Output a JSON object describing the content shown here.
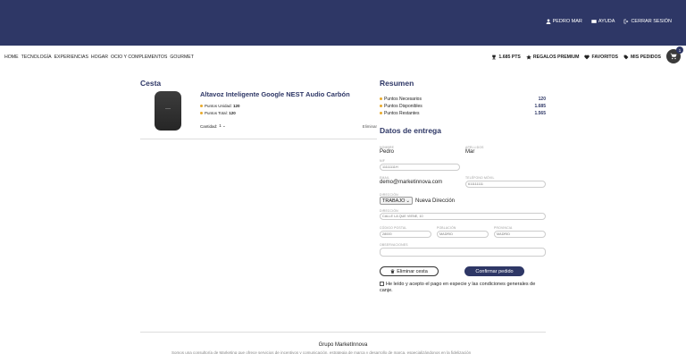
{
  "header": {
    "user_name": "PEDRO MAR",
    "help": "AYUDA",
    "logout": "CERRAR SESIÓN"
  },
  "menu": [
    "HOME",
    "TECNOLOGÍA",
    "EXPERIENCIAS",
    "HOGAR",
    "OCIO Y COMPLEMENTOS",
    "GOURMET"
  ],
  "right_menu": {
    "points": "1.685 PTS",
    "premium": "REGALOS PREMIUM",
    "favorites": "FAVORITOS",
    "orders": "MIS PEDIDOS",
    "cart_count": "1"
  },
  "cesta": {
    "title": "Cesta",
    "product_title": "Altavoz Inteligente Google NEST Audio Carbón",
    "unit_label": "Puntos Unidad:",
    "unit_value": "120",
    "total_label": "Puntos Total:",
    "total_value": "120",
    "qty_label": "Cantidad:",
    "qty_value": "1",
    "remove": "Eliminar"
  },
  "resumen": {
    "title": "Resumen",
    "rows": [
      {
        "label": "Puntos Necesarios",
        "value": "120"
      },
      {
        "label": "Puntos Disponibles",
        "value": "1.685"
      },
      {
        "label": "Puntos Restantes",
        "value": "1.565"
      }
    ]
  },
  "entrega": {
    "title": "Datos de entrega",
    "nombre_label": "NOMBRE",
    "nombre_value": "Pedro",
    "apellidos_label": "APELLIDOS",
    "apellidos_value": "Mar",
    "nif_label": "NIF",
    "nif_value": "11111111H",
    "email_label": "EMAIL",
    "email_value": "demo@marketinnova.com",
    "telefono_label": "TELÉFONO MÓVIL",
    "telefono_value": "611111111",
    "direccion_select_label": "DIRECCIÓN",
    "direccion_option": "TRABAJO",
    "nueva_direccion": "Nueva Dirección",
    "direccion_label": "DIRECCIÓN",
    "direccion_value": "CALLE LA QUE VIENE, 10",
    "cp_label": "CÓDIGO POSTAL",
    "cp_value": "28000",
    "poblacion_label": "POBLACIÓN",
    "poblacion_value": "MADRID",
    "provincia_label": "PROVINCIA",
    "provincia_value": "MADRID",
    "observaciones_label": "OBSERVACIONES",
    "observaciones_value": ""
  },
  "actions": {
    "delete_cart": "Eliminar cesta",
    "confirm": "Confirmar pedido",
    "terms": "He leído y acepto el pago en especie y las condiciones generales de canje."
  },
  "footer": {
    "title": "Grupo MarketInnova",
    "subtitle": "Somos una consultoría de Marketing que ofrece servicios de incentivos y comunicación, estrategia de marca y desarrollo de marca, especializándonos en la fidelización"
  }
}
